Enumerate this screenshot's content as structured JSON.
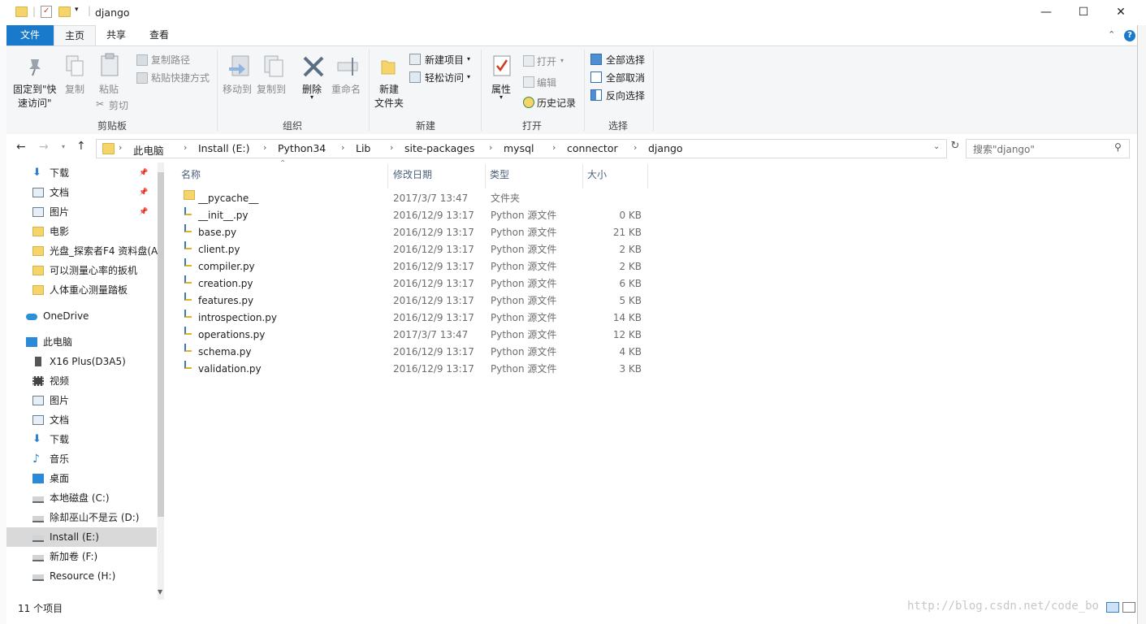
{
  "window": {
    "title": "django",
    "minimize": "—",
    "maximize": "☐",
    "close": "✕"
  },
  "ribbon_tabs": [
    "文件",
    "主页",
    "共享",
    "查看"
  ],
  "ribbon": {
    "clipboard": {
      "label": "剪贴板",
      "pin_line1": "固定到\"快",
      "pin_line2": "速访问\"",
      "copy": "复制",
      "paste": "粘贴",
      "copy_path": "复制路径",
      "paste_shortcut": "粘贴快捷方式",
      "cut": "剪切"
    },
    "organize": {
      "label": "组织",
      "move_to": "移动到",
      "copy_to": "复制到",
      "delete": "删除",
      "rename": "重命名"
    },
    "new": {
      "label": "新建",
      "new_folder_line1": "新建",
      "new_folder_line2": "文件夹",
      "new_item": "新建项目",
      "easy_access": "轻松访问"
    },
    "open": {
      "label": "打开",
      "properties": "属性",
      "open": "打开",
      "edit": "编辑",
      "history": "历史记录"
    },
    "select": {
      "label": "选择",
      "select_all": "全部选择",
      "select_none": "全部取消",
      "invert": "反向选择"
    }
  },
  "address": {
    "crumbs": [
      "此电脑",
      "Install (E:)",
      "Python34",
      "Lib",
      "site-packages",
      "mysql",
      "connector",
      "django"
    ],
    "search_placeholder": "搜索\"django\""
  },
  "nav": {
    "quick": [
      {
        "label": "下载",
        "pinned": true,
        "icon": "download-icon"
      },
      {
        "label": "文档",
        "pinned": true,
        "icon": "document-icon"
      },
      {
        "label": "图片",
        "pinned": true,
        "icon": "picture-icon"
      },
      {
        "label": "电影",
        "pinned": false,
        "icon": "folder-icon"
      },
      {
        "label": "光盘_探索者F4 资料盘(A",
        "pinned": false,
        "icon": "folder-icon"
      },
      {
        "label": "可以测量心率的扳机",
        "pinned": false,
        "icon": "folder-icon"
      },
      {
        "label": "人体重心测量踏板",
        "pinned": false,
        "icon": "folder-icon"
      }
    ],
    "onedrive": "OneDrive",
    "thispc": "此电脑",
    "pc_items": [
      {
        "label": "X16 Plus(D3A5)",
        "icon": "phone-icon"
      },
      {
        "label": "视频",
        "icon": "video-icon"
      },
      {
        "label": "图片",
        "icon": "picture-icon"
      },
      {
        "label": "文档",
        "icon": "document-icon"
      },
      {
        "label": "下载",
        "icon": "download-icon"
      },
      {
        "label": "音乐",
        "icon": "music-icon"
      },
      {
        "label": "桌面",
        "icon": "desktop-icon"
      },
      {
        "label": "本地磁盘 (C:)",
        "icon": "drive-icon"
      },
      {
        "label": "除却巫山不是云 (D:)",
        "icon": "drive-icon"
      },
      {
        "label": "Install (E:)",
        "icon": "drive-icon",
        "selected": true
      },
      {
        "label": "新加卷 (F:)",
        "icon": "drive-icon"
      },
      {
        "label": "Resource (H:)",
        "icon": "drive-icon"
      }
    ]
  },
  "columns": {
    "name": "名称",
    "date": "修改日期",
    "type": "类型",
    "size": "大小"
  },
  "files": [
    {
      "name": "__pycache__",
      "date": "2017/3/7 13:47",
      "type": "文件夹",
      "size": "",
      "kind": "folder"
    },
    {
      "name": "__init__.py",
      "date": "2016/12/9 13:17",
      "type": "Python 源文件",
      "size": "0 KB",
      "kind": "py"
    },
    {
      "name": "base.py",
      "date": "2016/12/9 13:17",
      "type": "Python 源文件",
      "size": "21 KB",
      "kind": "py"
    },
    {
      "name": "client.py",
      "date": "2016/12/9 13:17",
      "type": "Python 源文件",
      "size": "2 KB",
      "kind": "py"
    },
    {
      "name": "compiler.py",
      "date": "2016/12/9 13:17",
      "type": "Python 源文件",
      "size": "2 KB",
      "kind": "py"
    },
    {
      "name": "creation.py",
      "date": "2016/12/9 13:17",
      "type": "Python 源文件",
      "size": "6 KB",
      "kind": "py"
    },
    {
      "name": "features.py",
      "date": "2016/12/9 13:17",
      "type": "Python 源文件",
      "size": "5 KB",
      "kind": "py"
    },
    {
      "name": "introspection.py",
      "date": "2016/12/9 13:17",
      "type": "Python 源文件",
      "size": "14 KB",
      "kind": "py"
    },
    {
      "name": "operations.py",
      "date": "2017/3/7 13:47",
      "type": "Python 源文件",
      "size": "12 KB",
      "kind": "py"
    },
    {
      "name": "schema.py",
      "date": "2016/12/9 13:17",
      "type": "Python 源文件",
      "size": "4 KB",
      "kind": "py"
    },
    {
      "name": "validation.py",
      "date": "2016/12/9 13:17",
      "type": "Python 源文件",
      "size": "3 KB",
      "kind": "py"
    }
  ],
  "status": {
    "count": "11 个项目"
  },
  "watermark": "http://blog.csdn.net/code_bo",
  "colors": {
    "accent": "#1979ca",
    "folder": "#f4d46b",
    "selected": "#d9d9d9"
  }
}
